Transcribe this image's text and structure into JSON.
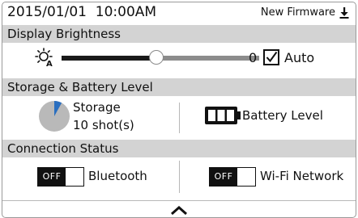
{
  "header": {
    "datetime": "2015/01/01  10:00AM",
    "firmware_label": "New Firmware",
    "firmware_icon": "download-icon"
  },
  "brightness": {
    "section_title": "Display Brightness",
    "icon": "auto-brightness-icon",
    "level": 0.48,
    "value": "0",
    "auto_checked": true,
    "auto_label": "Auto"
  },
  "storage_battery": {
    "section_title": "Storage & Battery Level",
    "storage_label": "Storage",
    "storage_shots": "10 shot(s)",
    "storage_used_fraction": 0.08,
    "battery_label": "Battery Level",
    "battery_bars": 3
  },
  "connection": {
    "section_title": "Connection Status",
    "bluetooth_toggle": "OFF",
    "bluetooth_label": "Bluetooth",
    "wifi_toggle": "OFF",
    "wifi_label": "Wi-Fi Network"
  },
  "footer": {
    "collapse_icon": "chevron-up-icon"
  },
  "colors": {
    "section_bar": "#d3d3d3",
    "pie_fill": "#b9b9b9",
    "pie_used": "#2a6fc0",
    "track_active": "#1a1a1a",
    "track_inactive": "#8c8c8c"
  }
}
